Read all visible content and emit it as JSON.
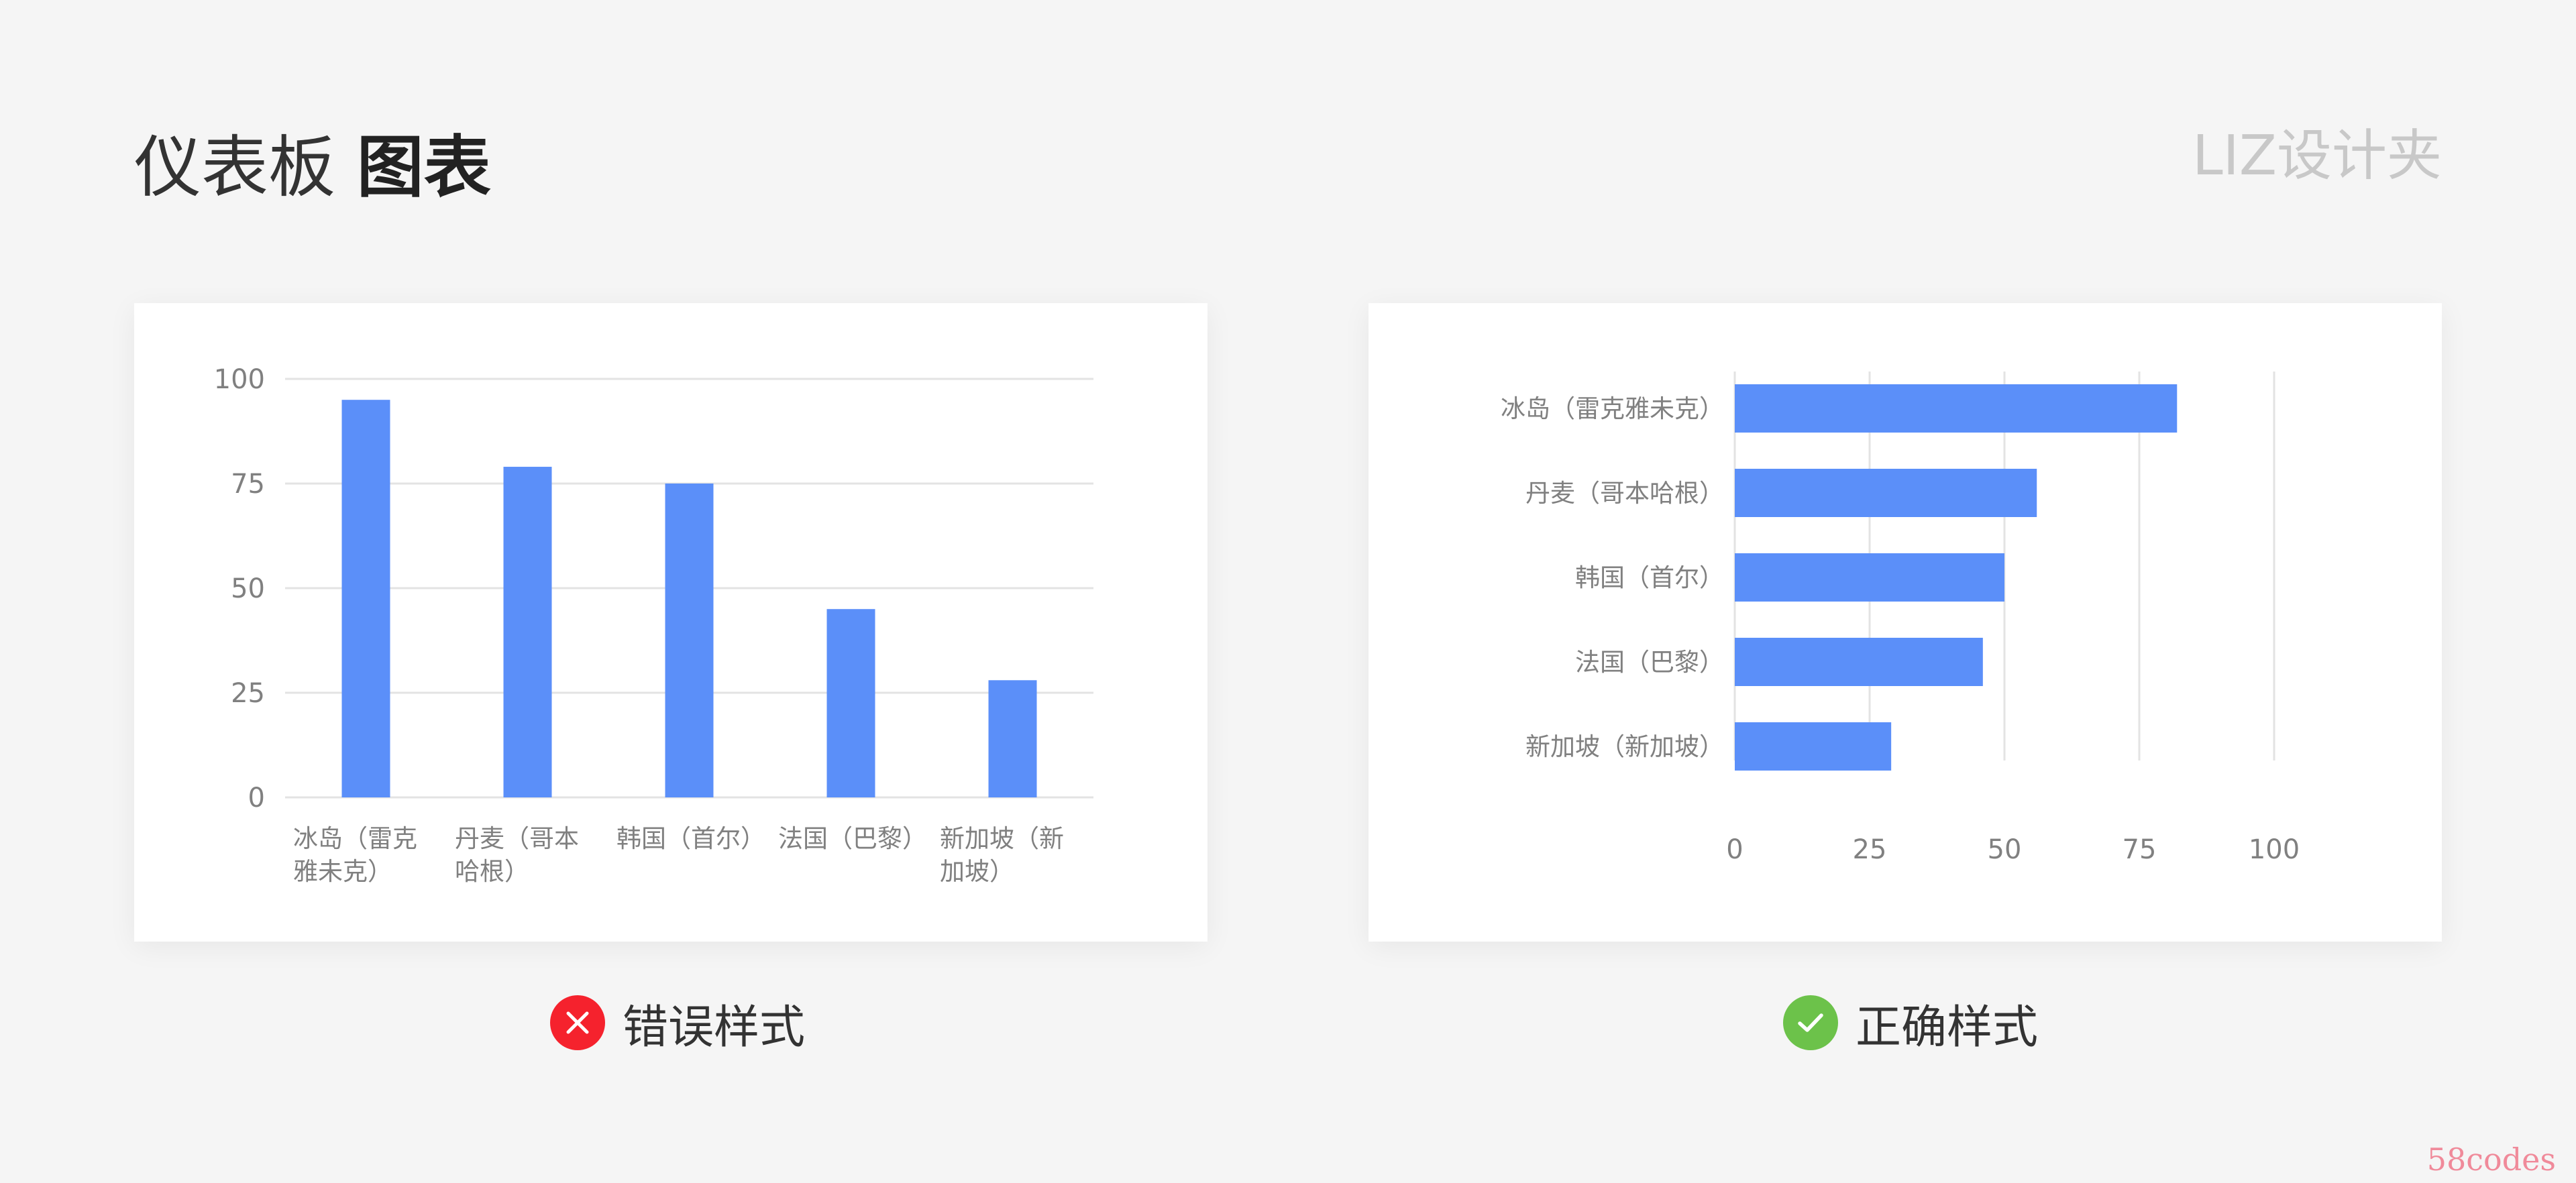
{
  "page": {
    "title_regular": "仪表板",
    "title_bold": "图表",
    "brand": "LIZ设计夹",
    "watermark": "58codes",
    "accent_color": "#5b8ff9"
  },
  "verdicts": {
    "wrong": {
      "label": "错误样式",
      "color": "#f5222d",
      "icon": "close-icon"
    },
    "right": {
      "label": "正确样式",
      "color": "#6cc24a",
      "icon": "check-icon"
    }
  },
  "chart_data": [
    {
      "type": "bar",
      "orientation": "vertical",
      "categories": [
        "冰岛（雷克雅未克）",
        "丹麦（哥本哈根）",
        "韩国（首尔）",
        "法国（巴黎）",
        "新加坡（新加坡）"
      ],
      "category_label_lines": [
        [
          "冰岛（雷克",
          "雅未克）"
        ],
        [
          "丹麦（哥本",
          "哈根）"
        ],
        [
          "韩国（首尔）"
        ],
        [
          "法国（巴黎）"
        ],
        [
          "新加坡（新",
          "加坡）"
        ]
      ],
      "values": [
        95,
        79,
        75,
        45,
        28
      ],
      "ticks": [
        0,
        25,
        50,
        75,
        100
      ],
      "ylim": [
        0,
        100
      ],
      "grid": true,
      "color": "#5b8ff9",
      "xlabel": "",
      "ylabel": ""
    },
    {
      "type": "bar",
      "orientation": "horizontal",
      "categories": [
        "冰岛（雷克雅未克）",
        "丹麦（哥本哈根）",
        "韩国（首尔）",
        "法国（巴黎）",
        "新加坡（新加坡）"
      ],
      "values": [
        82,
        56,
        50,
        46,
        29
      ],
      "ticks": [
        0,
        25,
        50,
        75,
        100
      ],
      "xlim": [
        0,
        100
      ],
      "grid": true,
      "color": "#5b8ff9",
      "xlabel": "",
      "ylabel": ""
    }
  ]
}
